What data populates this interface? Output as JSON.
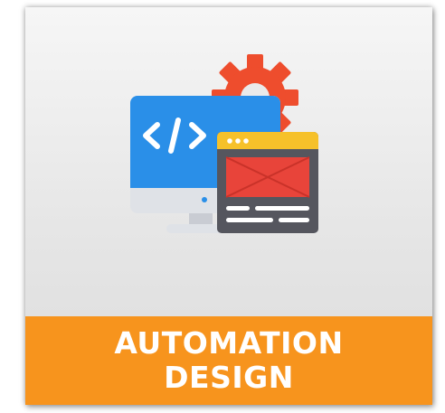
{
  "tile": {
    "title_line1": "AUTOMATION",
    "title_line2": "DESIGN",
    "icon": "automation-design-icon"
  },
  "colors": {
    "label_background": "#f7941d",
    "label_text": "#ffffff",
    "gear": "#ee4d2d",
    "monitor_screen": "#2a8fe8",
    "window_header": "#f6c12a",
    "window_body": "#55565e",
    "window_banner": "#e8443a"
  }
}
